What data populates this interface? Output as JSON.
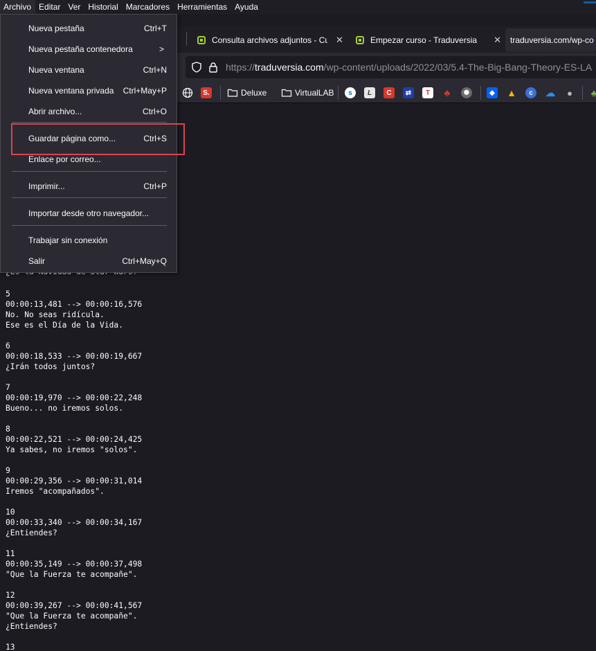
{
  "menubar": {
    "items": [
      "Archivo",
      "Editar",
      "Ver",
      "Historial",
      "Marcadores",
      "Herramientas",
      "Ayuda"
    ]
  },
  "tabs": [
    {
      "title": "Consulta archivos adjuntos - Cu",
      "close": "✕"
    },
    {
      "title": "Empezar curso - Traduversia",
      "close": "✕"
    },
    {
      "title": "traduversia.com/wp-co"
    }
  ],
  "urlbar": {
    "scheme": "https://",
    "host": "traduversia.com",
    "path": "/wp-content/uploads/2022/03/5.4-The-Big-Bang-Theory-ES-LA"
  },
  "bookmarks": [
    {
      "label": "Deluxe"
    },
    {
      "label": "VirtualLAB"
    }
  ],
  "file_menu": {
    "items": [
      {
        "label": "Nueva pestaña",
        "shortcut": "Ctrl+T"
      },
      {
        "label": "Nueva pestaña contenedora",
        "shortcut": ">"
      },
      {
        "label": "Nueva ventana",
        "shortcut": "Ctrl+N"
      },
      {
        "label": "Nueva ventana privada",
        "shortcut": "Ctrl+May+P"
      },
      {
        "label": "Abrir archivo...",
        "shortcut": "Ctrl+O"
      },
      {
        "label": "Guardar página como...",
        "shortcut": "Ctrl+S"
      },
      {
        "label": "Enlace por correo...",
        "shortcut": ""
      },
      {
        "label": "Imprimir...",
        "shortcut": "Ctrl+P"
      },
      {
        "label": "Importar desde otro navegador...",
        "shortcut": ""
      },
      {
        "label": "Trabajar sin conexión",
        "shortcut": ""
      },
      {
        "label": "Salir",
        "shortcut": "Ctrl+May+Q"
      }
    ]
  },
  "subtitles": {
    "partial_line": "¿Es la Navidad de Star Wars?",
    "entries": [
      {
        "index": "5",
        "time": "00:00:13,481 --> 00:00:16,576",
        "lines": [
          "No. No seas ridícula.",
          "Ese es el Día de la Vida."
        ]
      },
      {
        "index": "6",
        "time": "00:00:18,533 --> 00:00:19,667",
        "lines": [
          "¿Irán todos juntos?"
        ]
      },
      {
        "index": "7",
        "time": "00:00:19,970 --> 00:00:22,248",
        "lines": [
          "Bueno... no iremos solos."
        ]
      },
      {
        "index": "8",
        "time": "00:00:22,521 --> 00:00:24,425",
        "lines": [
          "Ya sabes, no iremos \"solos\"."
        ]
      },
      {
        "index": "9",
        "time": "00:00:29,356 --> 00:00:31,014",
        "lines": [
          "Iremos \"acompañados\"."
        ]
      },
      {
        "index": "10",
        "time": "00:00:33,340 --> 00:00:34,167",
        "lines": [
          "¿Entiendes?"
        ]
      },
      {
        "index": "11",
        "time": "00:00:35,149 --> 00:00:37,498",
        "lines": [
          "\"Que la Fuerza te acompañe\"."
        ]
      },
      {
        "index": "12",
        "time": "00:00:39,267 --> 00:00:41,567",
        "lines": [
          "\"Que la Fuerza te acompañe\".",
          "¿Entiendes?"
        ]
      },
      {
        "index": "13",
        "time": "",
        "lines": []
      }
    ]
  },
  "colors": {
    "highlight": "#e0424d",
    "background": "#1c1b22",
    "menu_bg": "#2b2a33"
  }
}
